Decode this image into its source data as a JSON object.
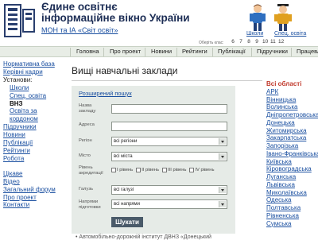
{
  "header": {
    "title_line1": "Єдине освітнє",
    "title_line2": "інформаційне вікно України",
    "org_link": "МОН та ІА «Світ освіт»",
    "grades_label": "Оберіть клас:",
    "grades": [
      "6",
      "7",
      "8",
      "9",
      "10",
      "11",
      "12"
    ],
    "mascot_schools": "Школи",
    "mascot_special": "Спец. освіта"
  },
  "nav": {
    "items": [
      "Головна",
      "Про проект",
      "Новини",
      "Рейтинги",
      "Публікації",
      "Підручники",
      "Працевл"
    ]
  },
  "sidebar": {
    "items": [
      {
        "label": "Нормативна база"
      },
      {
        "label": "Керівні кадри"
      }
    ],
    "institutions_label": "Установи:",
    "institutions": [
      {
        "label": "Школи"
      },
      {
        "label": "Спец. освіта"
      },
      {
        "label": "ВНЗ"
      },
      {
        "label": "Освіта за"
      },
      {
        "label": "кордоном"
      }
    ],
    "items2": [
      {
        "label": "Підручники"
      },
      {
        "label": "Новини"
      },
      {
        "label": "Публікації"
      },
      {
        "label": "Рейтинги"
      },
      {
        "label": "Робота"
      }
    ],
    "items3": [
      {
        "label": "Цікаве"
      },
      {
        "label": "Відео"
      },
      {
        "label": "Загальний форум"
      },
      {
        "label": "Про проект"
      },
      {
        "label": "Контакти"
      }
    ]
  },
  "main": {
    "title": "Вищі навчальні заклади",
    "advanced_search": "Розширений пошук",
    "fields": {
      "name_label": "Назва закладу",
      "address_label": "Адреса",
      "region_label": "Регіон",
      "region_value": "всі регіони",
      "city_label": "Місто",
      "city_value": "всі міста",
      "accreditation_label": "Рівень акредитації",
      "levels": [
        "I рівень",
        "II рівень",
        "III рівень",
        "IV рівень"
      ],
      "branch_label": "Галузь",
      "branch_value": "всі галузі",
      "direction_label": "Напрями підготовки",
      "direction_value": "всі напрями"
    },
    "search_button": "Шукати",
    "result_preview": "• Автомобільно-дорожній інститут ДВНЗ «Донецький"
  },
  "regions": {
    "all": "Всі області",
    "items": [
      "АРК",
      "Вінницька",
      "Волинська",
      "Дніпропетровська",
      "Донецька",
      "Житомирська",
      "Закарпатська",
      "Запорізька",
      "Івано-Франківська",
      "Київська",
      "Кіровоградська",
      "Луганська",
      "Львівська",
      "Миколаївська",
      "Одеська",
      "Полтавська",
      "Рівненська",
      "Сумська"
    ]
  }
}
